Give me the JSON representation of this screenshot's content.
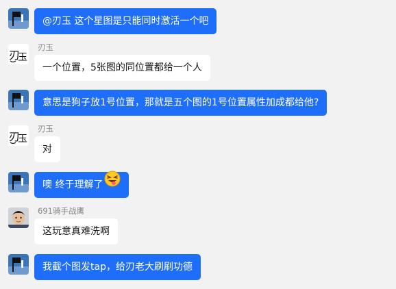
{
  "colors": {
    "background": "#f2f2f2",
    "outgoing_bubble": "#1f6efa",
    "incoming_bubble": "#ffffff",
    "sender_name": "#888888"
  },
  "messages": [
    {
      "direction": "out",
      "sender": "",
      "avatar": "blue-flag-avatar",
      "text": "@刃玉 这个星图是只能同时激活一个吧"
    },
    {
      "direction": "in",
      "sender": "刃玉",
      "avatar": "calligraphy-avatar",
      "text": "一个位置，5张图的同位置都给一个人"
    },
    {
      "direction": "out",
      "sender": "",
      "avatar": "blue-flag-avatar",
      "text": "意思是狗子放1号位置，那就是五个图的1号位置属性加成都给他?"
    },
    {
      "direction": "in",
      "sender": "刃玉",
      "avatar": "calligraphy-avatar",
      "text": "对"
    },
    {
      "direction": "out",
      "sender": "",
      "avatar": "blue-flag-avatar",
      "text": "噢 终于理解了",
      "emoji": "laughing-tongue-emoji"
    },
    {
      "direction": "in",
      "sender": "691骑手战鹰",
      "avatar": "person-photo-avatar",
      "text": "这玩意真难洗啊"
    },
    {
      "direction": "out",
      "sender": "",
      "avatar": "blue-flag-avatar",
      "text": "我截个图发tap，给刃老大刷刷功德"
    }
  ]
}
